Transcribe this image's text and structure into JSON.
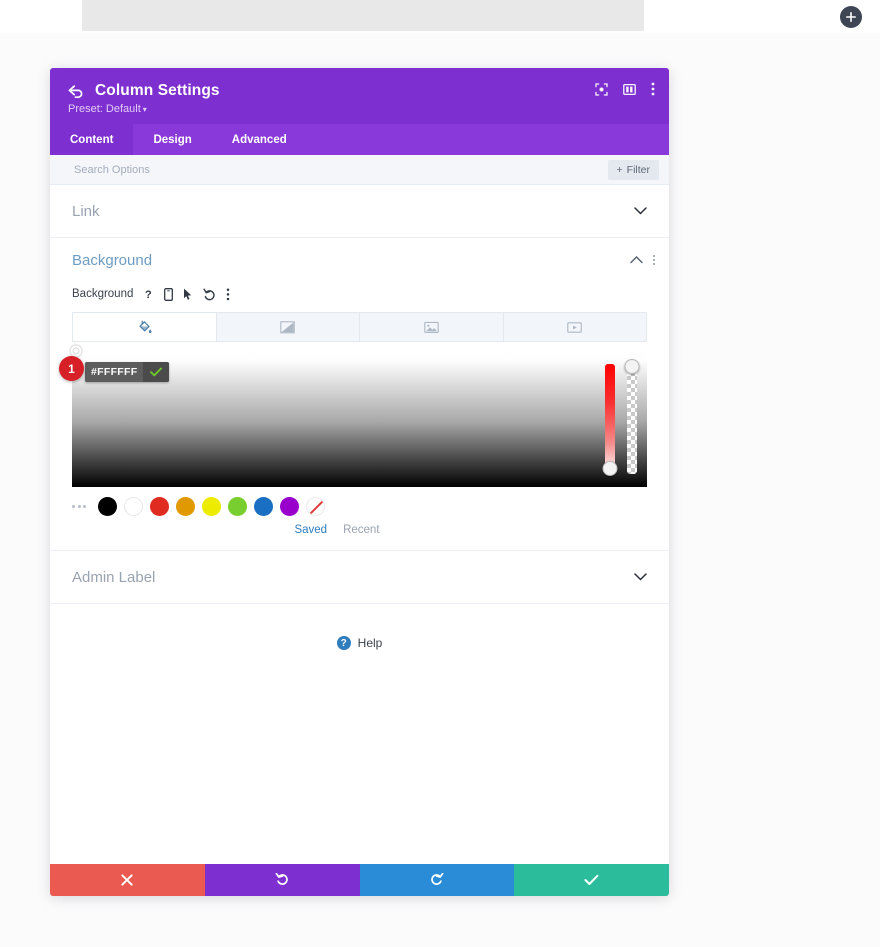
{
  "canvas": {
    "add_button_icon": "plus-icon"
  },
  "modal": {
    "title": "Column Settings",
    "preset_label": "Preset: Default",
    "preset_caret": "▾",
    "back_icon": "back-arrow-icon",
    "header_icons": [
      {
        "name": "focus-target-icon"
      },
      {
        "name": "layout-panel-icon"
      },
      {
        "name": "more-vertical-icon"
      }
    ],
    "tabs": [
      {
        "label": "Content",
        "active": true
      },
      {
        "label": "Design",
        "active": false
      },
      {
        "label": "Advanced",
        "active": false
      }
    ],
    "search": {
      "placeholder": "Search Options",
      "value": "",
      "filter_label": "Filter",
      "filter_plus": "+"
    },
    "sections": [
      {
        "label": "Link",
        "state": "collapsed",
        "chevron": "⌄"
      },
      {
        "label": "Background",
        "state": "expanded"
      },
      {
        "label": "Admin Label",
        "state": "collapsed",
        "chevron": "⌄"
      }
    ],
    "background_section": {
      "heading": "Background",
      "field_label": "Background",
      "field_icons": [
        {
          "name": "help-question-icon",
          "glyph": "?"
        },
        {
          "name": "responsive-phone-icon"
        },
        {
          "name": "hover-cursor-icon"
        },
        {
          "name": "reset-undo-icon"
        },
        {
          "name": "more-options-icon"
        }
      ],
      "type_tabs": [
        {
          "name": "background-color-tab",
          "icon": "paint-bucket-icon",
          "active": true
        },
        {
          "name": "background-gradient-tab",
          "icon": "gradient-icon",
          "active": false
        },
        {
          "name": "background-image-tab",
          "icon": "image-icon",
          "active": false
        },
        {
          "name": "background-video-tab",
          "icon": "video-icon",
          "active": false
        }
      ],
      "color_picker": {
        "hex_value": "#FFFFFF",
        "confirm_icon": "checkmark-icon",
        "step_badge": "1",
        "hue_slider_name": "hue-slider",
        "alpha_slider_name": "alpha-slider"
      },
      "swatches": [
        {
          "name": "swatch-black",
          "color": "#000000"
        },
        {
          "name": "swatch-white",
          "color": "#FFFFFF"
        },
        {
          "name": "swatch-red",
          "color": "#E02B20"
        },
        {
          "name": "swatch-orange",
          "color": "#E09900"
        },
        {
          "name": "swatch-yellow",
          "color": "#EDEB00"
        },
        {
          "name": "swatch-green",
          "color": "#78CE2E"
        },
        {
          "name": "swatch-blue",
          "color": "#1B6FC2"
        },
        {
          "name": "swatch-purple",
          "color": "#9900CC"
        },
        {
          "name": "swatch-transparent",
          "color": "transparent"
        }
      ],
      "palette_tabs": [
        {
          "label": "Saved",
          "active": true
        },
        {
          "label": "Recent",
          "active": false
        }
      ]
    },
    "help": {
      "label": "Help",
      "icon_glyph": "?"
    },
    "footer_buttons": [
      {
        "name": "cancel-button",
        "icon": "close-x-icon",
        "color": "#EA5A51"
      },
      {
        "name": "undo-button",
        "icon": "undo-arrow-icon",
        "color": "#7D2FD0"
      },
      {
        "name": "redo-button",
        "icon": "redo-arrow-icon",
        "color": "#2A8CD6"
      },
      {
        "name": "save-button",
        "icon": "checkmark-icon",
        "color": "#2BBD9B"
      }
    ]
  }
}
